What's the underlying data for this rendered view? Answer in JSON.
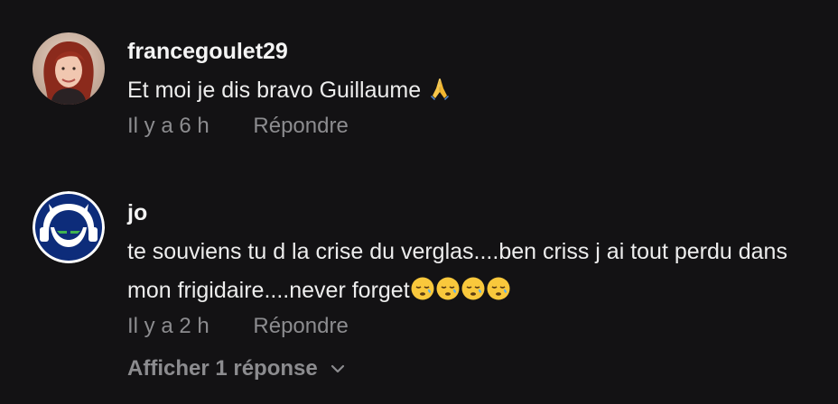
{
  "comments": [
    {
      "username": "francegoulet29",
      "text": "Et moi je dis bravo Guillaume",
      "emoji": "folded-hands-icon",
      "time": "Il y a 6 h",
      "reply_label": "Répondre"
    },
    {
      "username": "jo",
      "text": "te souviens tu d la crise du verglas....ben criss j ai tout perdu dans mon frigidaire....never forget",
      "emoji": "sleepy-face-icon",
      "emoji_count": 4,
      "time": "Il y a 2 h",
      "reply_label": "Répondre"
    }
  ],
  "view_replies_label": "Afficher 1 réponse",
  "colors": {
    "background": "#131214",
    "text": "#ededed",
    "muted": "#8c8c8f"
  }
}
